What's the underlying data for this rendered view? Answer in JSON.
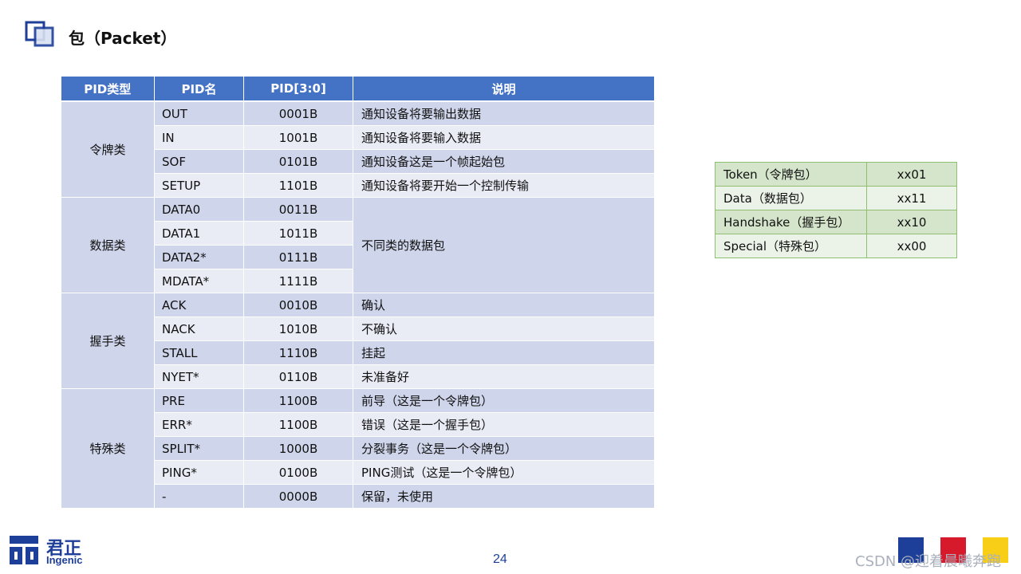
{
  "title": "包（Packet）",
  "table": {
    "headers": [
      "PID类型",
      "PID名",
      "PID[3:0]",
      "说明"
    ],
    "groups": [
      {
        "type": "令牌类",
        "rows": [
          {
            "name": "OUT",
            "code": "0001B",
            "desc": "通知设备将要输出数据"
          },
          {
            "name": "IN",
            "code": "1001B",
            "desc": "通知设备将要输入数据"
          },
          {
            "name": "SOF",
            "code": "0101B",
            "desc": "通知设备这是一个帧起始包"
          },
          {
            "name": "SETUP",
            "code": "1101B",
            "desc": "通知设备将要开始一个控制传输"
          }
        ]
      },
      {
        "type": "数据类",
        "shared_desc": "不同类的数据包",
        "rows": [
          {
            "name": "DATA0",
            "code": "0011B"
          },
          {
            "name": "DATA1",
            "code": "1011B"
          },
          {
            "name": "DATA2*",
            "code": "0111B"
          },
          {
            "name": "MDATA*",
            "code": "1111B"
          }
        ]
      },
      {
        "type": "握手类",
        "rows": [
          {
            "name": "ACK",
            "code": "0010B",
            "desc": "确认"
          },
          {
            "name": "NACK",
            "code": "1010B",
            "desc": "不确认"
          },
          {
            "name": "STALL",
            "code": "1110B",
            "desc": "挂起"
          },
          {
            "name": "NYET*",
            "code": "0110B",
            "desc": "未准备好"
          }
        ]
      },
      {
        "type": "特殊类",
        "rows": [
          {
            "name": "PRE",
            "code": "1100B",
            "desc": "前导（这是一个令牌包）"
          },
          {
            "name": "ERR*",
            "code": "1100B",
            "desc": "错误（这是一个握手包）"
          },
          {
            "name": "SPLIT*",
            "code": "1000B",
            "desc": "分裂事务（这是一个令牌包）"
          },
          {
            "name": "PING*",
            "code": "0100B",
            "desc": "PING测试（这是一个令牌包）"
          },
          {
            "name": "-",
            "code": "0000B",
            "desc": "保留，未使用"
          }
        ]
      }
    ]
  },
  "summary": [
    {
      "label": "Token（令牌包）",
      "value": "xx01"
    },
    {
      "label": "Data（数据包）",
      "value": "xx11"
    },
    {
      "label": "Handshake（握手包）",
      "value": "xx10"
    },
    {
      "label": "Special（特殊包）",
      "value": "xx00"
    }
  ],
  "footer": {
    "logo_cn": "君正",
    "logo_en": "Ingenic",
    "page_number": "24",
    "watermark": "CSDN @迎着晨曦奔跑"
  },
  "colors": {
    "header_blue": "#4472c4",
    "row_dark": "#cfd5ea",
    "row_light": "#e9ebf5",
    "summary_dark": "#d5e5cb",
    "summary_light": "#ebf2e7",
    "brand_blue": "#1e3f99",
    "square_red": "#d7192c",
    "square_yellow": "#f8cf16"
  }
}
